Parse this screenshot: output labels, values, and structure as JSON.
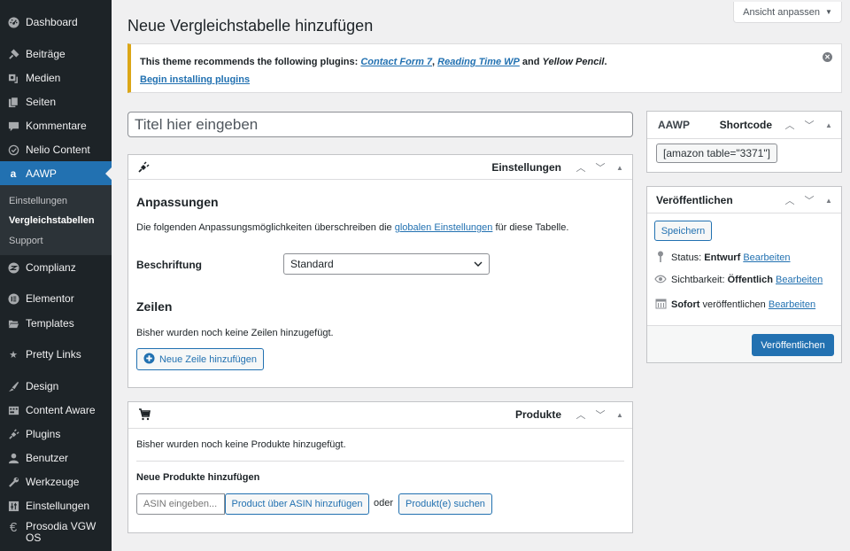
{
  "sidebar": {
    "items": [
      {
        "label": "Dashboard",
        "icon": "dashboard-icon"
      },
      {
        "label": "Beiträge",
        "icon": "pin-icon"
      },
      {
        "label": "Medien",
        "icon": "media-icon"
      },
      {
        "label": "Seiten",
        "icon": "pages-icon"
      },
      {
        "label": "Kommentare",
        "icon": "comment-icon"
      },
      {
        "label": "Nelio Content",
        "icon": "nelio-icon"
      },
      {
        "label": "AAWP",
        "icon": "amazon-icon",
        "active": true
      },
      {
        "label": "Complianz",
        "icon": "complianz-icon"
      },
      {
        "label": "Elementor",
        "icon": "elementor-icon"
      },
      {
        "label": "Templates",
        "icon": "folder-icon"
      },
      {
        "label": "Pretty Links",
        "icon": "star-icon"
      },
      {
        "label": "Design",
        "icon": "brush-icon"
      },
      {
        "label": "Content Aware",
        "icon": "layout-icon"
      },
      {
        "label": "Plugins",
        "icon": "plugin-icon"
      },
      {
        "label": "Benutzer",
        "icon": "user-icon"
      },
      {
        "label": "Werkzeuge",
        "icon": "wrench-icon"
      },
      {
        "label": "Einstellungen",
        "icon": "settings-icon"
      },
      {
        "label": "Prosodia VGW OS",
        "icon": "euro-icon"
      }
    ],
    "submenu": [
      {
        "label": "Einstellungen"
      },
      {
        "label": "Vergleichstabellen",
        "current": true
      },
      {
        "label": "Support"
      }
    ]
  },
  "screen_options": {
    "label": "Ansicht anpassen",
    "caret": "▼"
  },
  "page_title": "Neue Vergleichstabelle hinzufügen",
  "notice": {
    "prefix": "This theme recommends the following plugins: ",
    "plugin1": "Contact Form 7",
    "sep": ", ",
    "plugin2": "Reading Time WP",
    "and": " and ",
    "plugin3": "Yellow Pencil",
    "suffix": ".",
    "install_link": "Begin installing plugins",
    "accent_color": "#dba617"
  },
  "title_input": {
    "placeholder": "Titel hier eingeben",
    "value": ""
  },
  "settings_box": {
    "title": "Einstellungen",
    "section1_heading": "Anpassungen",
    "description_before": "Die folgenden Anpassungsmöglichkeiten überschreiben die ",
    "description_link": "globalen Einstellungen",
    "description_after": " für diese Tabelle.",
    "caption_label": "Beschriftung",
    "caption_value": "Standard",
    "section2_heading": "Zeilen",
    "rows_empty": "Bisher wurden noch keine Zeilen hinzugefügt.",
    "add_row_button": "Neue Zeile hinzufügen"
  },
  "products_box": {
    "title": "Produkte",
    "empty": "Bisher wurden noch keine Produkte hinzugefügt.",
    "add_heading": "Neue Produkte hinzufügen",
    "asin_placeholder": "ASIN eingeben...",
    "add_by_asin_button": "Product über ASIN hinzufügen",
    "or_label": "oder",
    "search_button": "Produkt(e) suchen"
  },
  "shortcode_box": {
    "logo": "AAWP",
    "title": "Shortcode",
    "value": "[amazon table=\"3371\"]"
  },
  "publish_box": {
    "title": "Veröffentlichen",
    "save_button": "Speichern",
    "status_label": "Status: ",
    "status_value": "Entwurf",
    "visibility_label": "Sichtbarkeit: ",
    "visibility_value": "Öffentlich",
    "schedule_value": "Sofort",
    "schedule_label": " veröffentlichen",
    "edit_link": "Bearbeiten",
    "publish_button": "Veröffentlichen",
    "primary_color": "#2271b1"
  }
}
